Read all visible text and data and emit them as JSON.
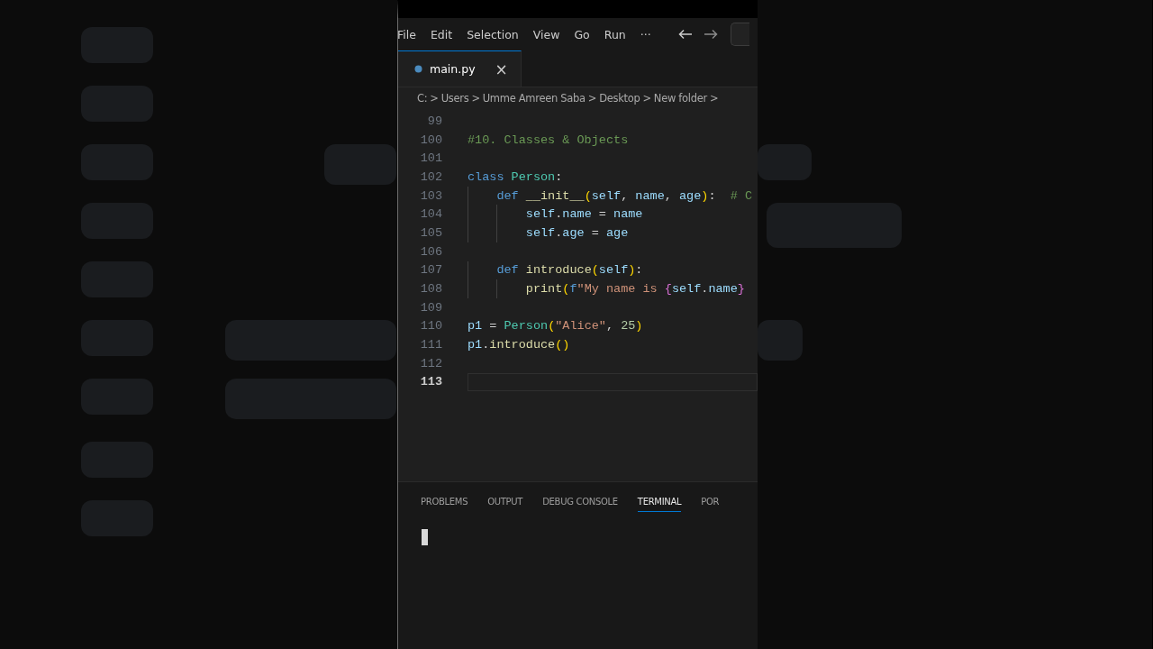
{
  "menu": [
    "File",
    "Edit",
    "Selection",
    "View",
    "Go",
    "Run",
    "···"
  ],
  "tabs": [
    {
      "label": "main.py",
      "selected": true,
      "close": "×"
    }
  ],
  "breadcrumbs": [
    "C:",
    "Users",
    "Umme Amreen Saba",
    "Desktop",
    "New folder"
  ],
  "breadcrumb_separator": ">",
  "code_lines": [
    {
      "number": "99",
      "current": false
    },
    {
      "number": "100",
      "current": false,
      "tokens": [
        {
          "text": "#10. Classes & Objects",
          "kind": "comment"
        }
      ]
    },
    {
      "number": "101",
      "current": false
    },
    {
      "number": "102",
      "current": false,
      "tokens": [
        {
          "text": "class",
          "kind": "keyword"
        },
        {
          "text": " Person",
          "kind": "class"
        },
        {
          "text": ":",
          "kind": "plain"
        }
      ]
    },
    {
      "number": "103",
      "current": false,
      "tokens": [
        {
          "text": "    def",
          "kind": "keyword"
        },
        {
          "text": " __init__",
          "kind": "func"
        },
        {
          "text": "(",
          "kind": "bracket"
        },
        {
          "text": "self",
          "kind": "param"
        },
        {
          "text": ", ",
          "kind": "plain"
        },
        {
          "text": "name",
          "kind": "param"
        },
        {
          "text": ", ",
          "kind": "plain"
        },
        {
          "text": "age",
          "kind": "param"
        },
        {
          "text": ")",
          "kind": "bracket"
        },
        {
          "text": ":  ",
          "kind": "plain"
        },
        {
          "text": "# C",
          "kind": "comment"
        }
      ]
    },
    {
      "number": "104",
      "current": false,
      "tokens": [
        {
          "text": "        self",
          "kind": "param"
        },
        {
          "text": ".",
          "kind": "plain"
        },
        {
          "text": "name",
          "kind": "param"
        },
        {
          "text": " = ",
          "kind": "plain"
        },
        {
          "text": "name",
          "kind": "param"
        }
      ]
    },
    {
      "number": "105",
      "current": false,
      "tokens": [
        {
          "text": "        self",
          "kind": "param"
        },
        {
          "text": ".",
          "kind": "plain"
        },
        {
          "text": "age",
          "kind": "param"
        },
        {
          "text": " = ",
          "kind": "plain"
        },
        {
          "text": "age",
          "kind": "param"
        }
      ]
    },
    {
      "number": "106",
      "current": false
    },
    {
      "number": "107",
      "current": false,
      "tokens": [
        {
          "text": "    def",
          "kind": "keyword"
        },
        {
          "text": " introduce",
          "kind": "func"
        },
        {
          "text": "(",
          "kind": "bracket"
        },
        {
          "text": "self",
          "kind": "param"
        },
        {
          "text": ")",
          "kind": "bracket"
        },
        {
          "text": ":",
          "kind": "plain"
        }
      ]
    },
    {
      "number": "108",
      "current": false,
      "tokens": [
        {
          "text": "        print",
          "kind": "func"
        },
        {
          "text": "(",
          "kind": "bracket"
        },
        {
          "text": "f",
          "kind": "keyword"
        },
        {
          "text": "\"My name is ",
          "kind": "string"
        },
        {
          "text": "{",
          "kind": "brace"
        },
        {
          "text": "self",
          "kind": "param"
        },
        {
          "text": ".",
          "kind": "plain"
        },
        {
          "text": "name",
          "kind": "param"
        },
        {
          "text": "}",
          "kind": "brace"
        }
      ]
    },
    {
      "number": "109",
      "current": false
    },
    {
      "number": "110",
      "current": false,
      "tokens": [
        {
          "text": "p1",
          "kind": "param"
        },
        {
          "text": " = ",
          "kind": "plain"
        },
        {
          "text": "Person",
          "kind": "class"
        },
        {
          "text": "(",
          "kind": "bracket"
        },
        {
          "text": "\"Alice\"",
          "kind": "string"
        },
        {
          "text": ", ",
          "kind": "plain"
        },
        {
          "text": "25",
          "kind": "number"
        },
        {
          "text": ")",
          "kind": "bracket"
        }
      ]
    },
    {
      "number": "111",
      "current": false,
      "tokens": [
        {
          "text": "p1",
          "kind": "param"
        },
        {
          "text": ".",
          "kind": "plain"
        },
        {
          "text": "introduce",
          "kind": "func"
        },
        {
          "text": "()",
          "kind": "bracket"
        }
      ]
    },
    {
      "number": "112",
      "current": false
    },
    {
      "number": "113",
      "current": true
    }
  ],
  "panel_tabs": [
    {
      "label": "PROBLEMS",
      "selected": false
    },
    {
      "label": "OUTPUT",
      "selected": false
    },
    {
      "label": "DEBUG CONSOLE",
      "selected": false
    },
    {
      "label": "TERMINAL",
      "selected": true
    },
    {
      "label": "POR",
      "selected": false
    }
  ]
}
